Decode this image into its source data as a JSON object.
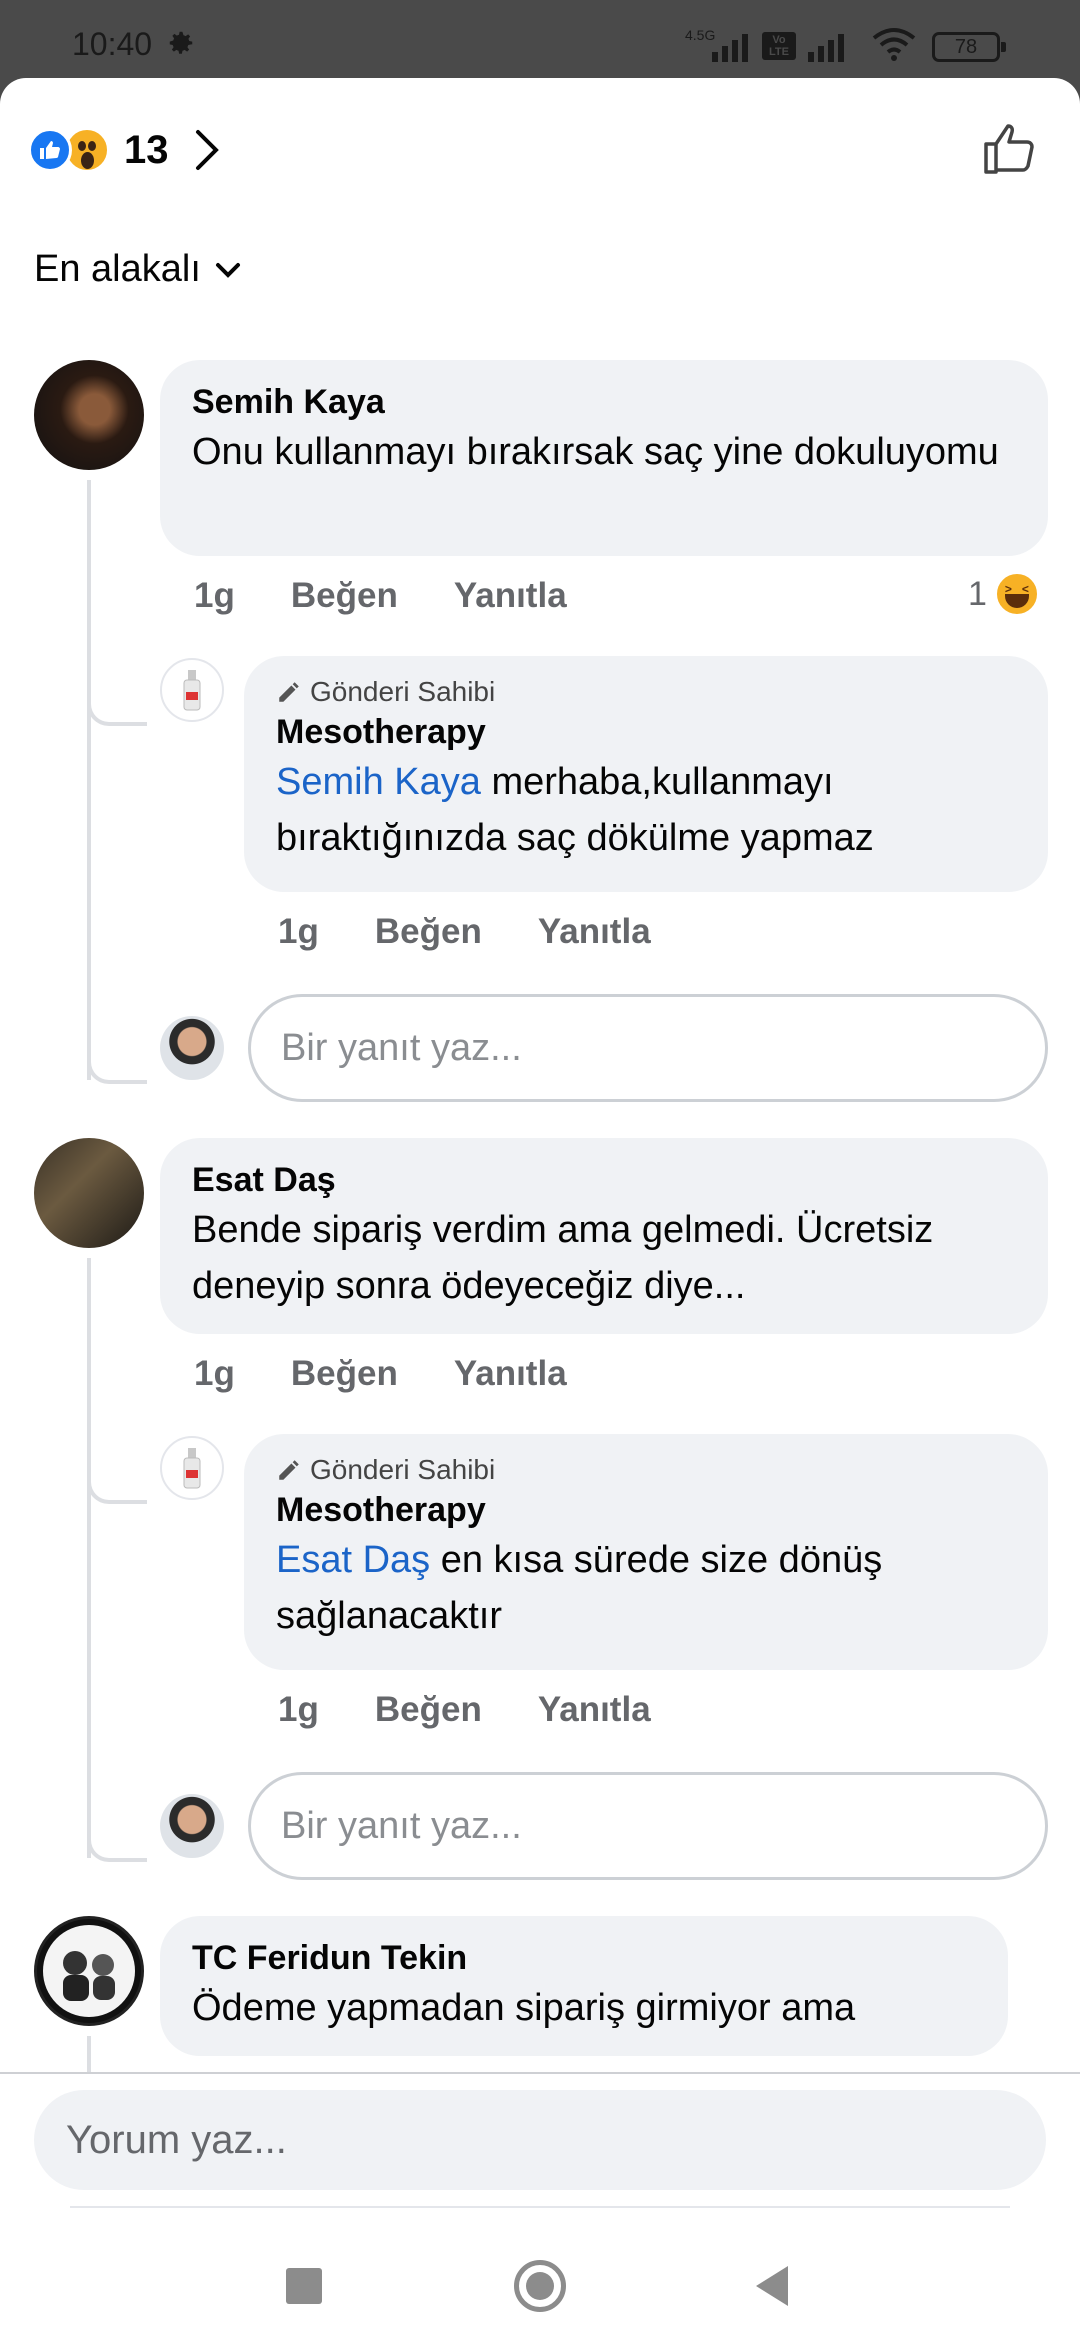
{
  "status_bar": {
    "time": "10:40",
    "network_label": "4.5G",
    "volte_label": "Vo LTE",
    "battery": "78"
  },
  "reactions": {
    "count": "13",
    "icons": [
      "like-icon",
      "wow-icon"
    ]
  },
  "sort": {
    "label": "En alakalı"
  },
  "comments": [
    {
      "author": "Semih Kaya",
      "text": "Onu kullanmayı bırakırsak saç yine dokuluyomu",
      "time": "1g",
      "like": "Beğen",
      "reply": "Yanıtla",
      "reaction_count": "1",
      "replies": [
        {
          "owner_badge": "Gönderi Sahibi",
          "author": "Mesotherapy",
          "mention": "Semih Kaya",
          "text": " merhaba,kullanmayı bıraktığınızda saç dökülme yapmaz",
          "time": "1g",
          "like": "Beğen",
          "reply": "Yanıtla"
        }
      ],
      "reply_placeholder": "Bir yanıt yaz..."
    },
    {
      "author": "Esat Daş",
      "text": "Bende sipariş verdim ama gelmedi. Ücretsiz deneyip sonra ödeyeceğiz diye...",
      "time": "1g",
      "like": "Beğen",
      "reply": "Yanıtla",
      "replies": [
        {
          "owner_badge": "Gönderi Sahibi",
          "author": "Mesotherapy",
          "mention": "Esat Daş",
          "text": " en kısa sürede size dönüş sağlanacaktır",
          "time": "1g",
          "like": "Beğen",
          "reply": "Yanıtla"
        }
      ],
      "reply_placeholder": "Bir yanıt yaz..."
    },
    {
      "author": "TC Feridun Tekin",
      "text": "Ödeme yapmadan sipariş girmiyor ama"
    }
  ],
  "composer": {
    "placeholder": "Yorum yaz..."
  },
  "colors": {
    "accent": "#1877f2",
    "mention": "#1b64c8",
    "bubble": "#f0f2f5",
    "muted": "#65676b"
  }
}
